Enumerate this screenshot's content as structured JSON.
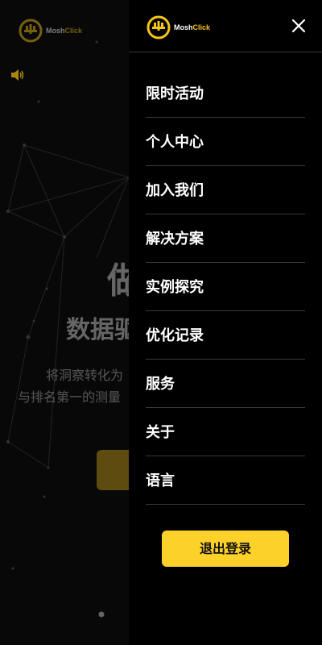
{
  "brand": {
    "logo_name_part1": "Mosh",
    "logo_name_part2": "Click",
    "accent_color": "#fcd12a"
  },
  "background_page": {
    "hero_title": "做",
    "hero_subtitle": "数据驱",
    "description_line1": "将洞察转化为",
    "description_line2": "与排名第一的测量"
  },
  "drawer": {
    "close_icon": "close-icon",
    "menu_items": [
      {
        "label": "限时活动"
      },
      {
        "label": "个人中心"
      },
      {
        "label": "加入我们"
      },
      {
        "label": "解决方案"
      },
      {
        "label": "实例探究"
      },
      {
        "label": "优化记录"
      },
      {
        "label": "服务"
      },
      {
        "label": "关于"
      },
      {
        "label": "语言"
      }
    ],
    "logout_label": "退出登录"
  }
}
